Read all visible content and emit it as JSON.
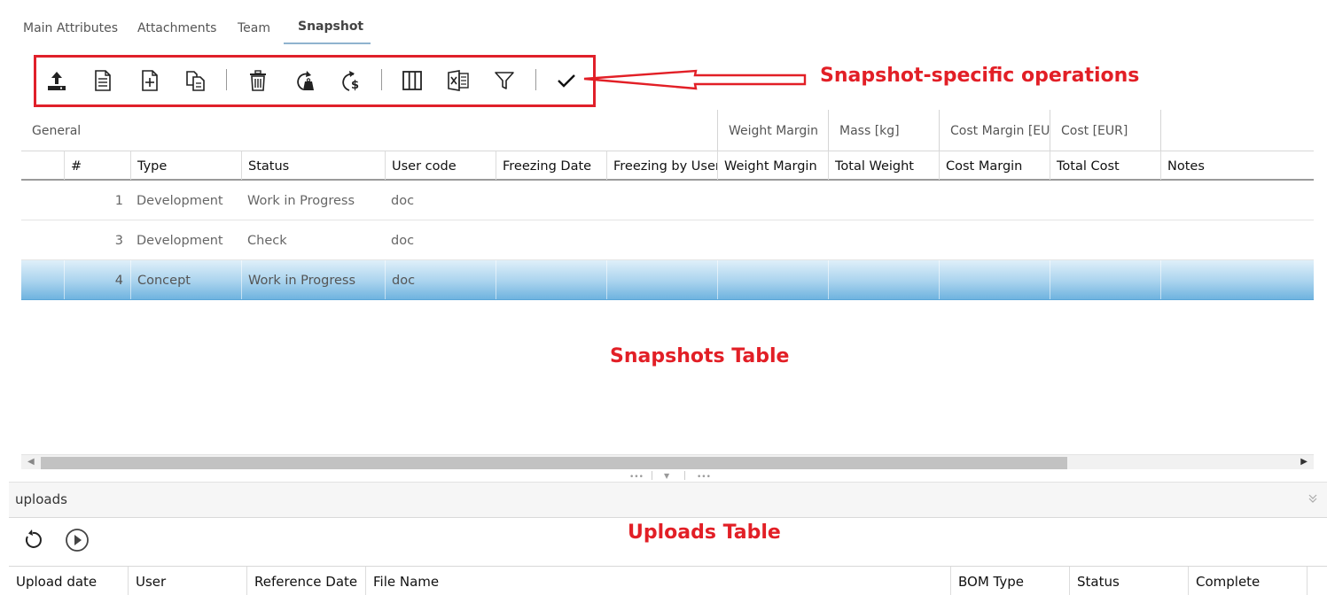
{
  "tabs": [
    {
      "label": "Main Attributes"
    },
    {
      "label": "Attachments"
    },
    {
      "label": "Team"
    },
    {
      "label": "Snapshot"
    }
  ],
  "toolbar": {
    "icons": [
      "upload-icon",
      "document-icon",
      "add-document-icon",
      "copy-documents-icon",
      "delete-icon",
      "recalculate-weight-icon",
      "recalculate-cost-icon",
      "columns-icon",
      "excel-export-icon",
      "filter-icon",
      "check-icon"
    ]
  },
  "annotations": {
    "snapshot_ops": "Snapshot-specific operations",
    "snapshots_table": "Snapshots Table",
    "uploads_table": "Uploads Table"
  },
  "snapshot_table": {
    "groups": [
      "General",
      "Weight Margin",
      "Mass [kg]",
      "Cost Margin [EUR]",
      "Cost [EUR]"
    ],
    "columns": [
      "#",
      "Type",
      "Status",
      "User code",
      "Freezing Date",
      "Freezing by User",
      "Weight Margin",
      "Total Weight",
      "Cost Margin",
      "Total Cost",
      "Notes"
    ],
    "rows": [
      {
        "num": "1",
        "type": "Development",
        "status": "Work in Progress",
        "user_code": "doc",
        "selected": false
      },
      {
        "num": "3",
        "type": "Development",
        "status": "Check",
        "user_code": "doc",
        "selected": false
      },
      {
        "num": "4",
        "type": "Concept",
        "status": "Work in Progress",
        "user_code": "doc",
        "selected": true
      }
    ]
  },
  "uploads": {
    "title": "uploads",
    "columns": [
      "Upload date",
      "User",
      "Reference Date",
      "File Name",
      "BOM Type",
      "Status",
      "Complete"
    ]
  },
  "colors": {
    "annotation_red": "#e21f26",
    "selected_row": "#6fb3df",
    "tab_underline": "#8fb3cf"
  }
}
